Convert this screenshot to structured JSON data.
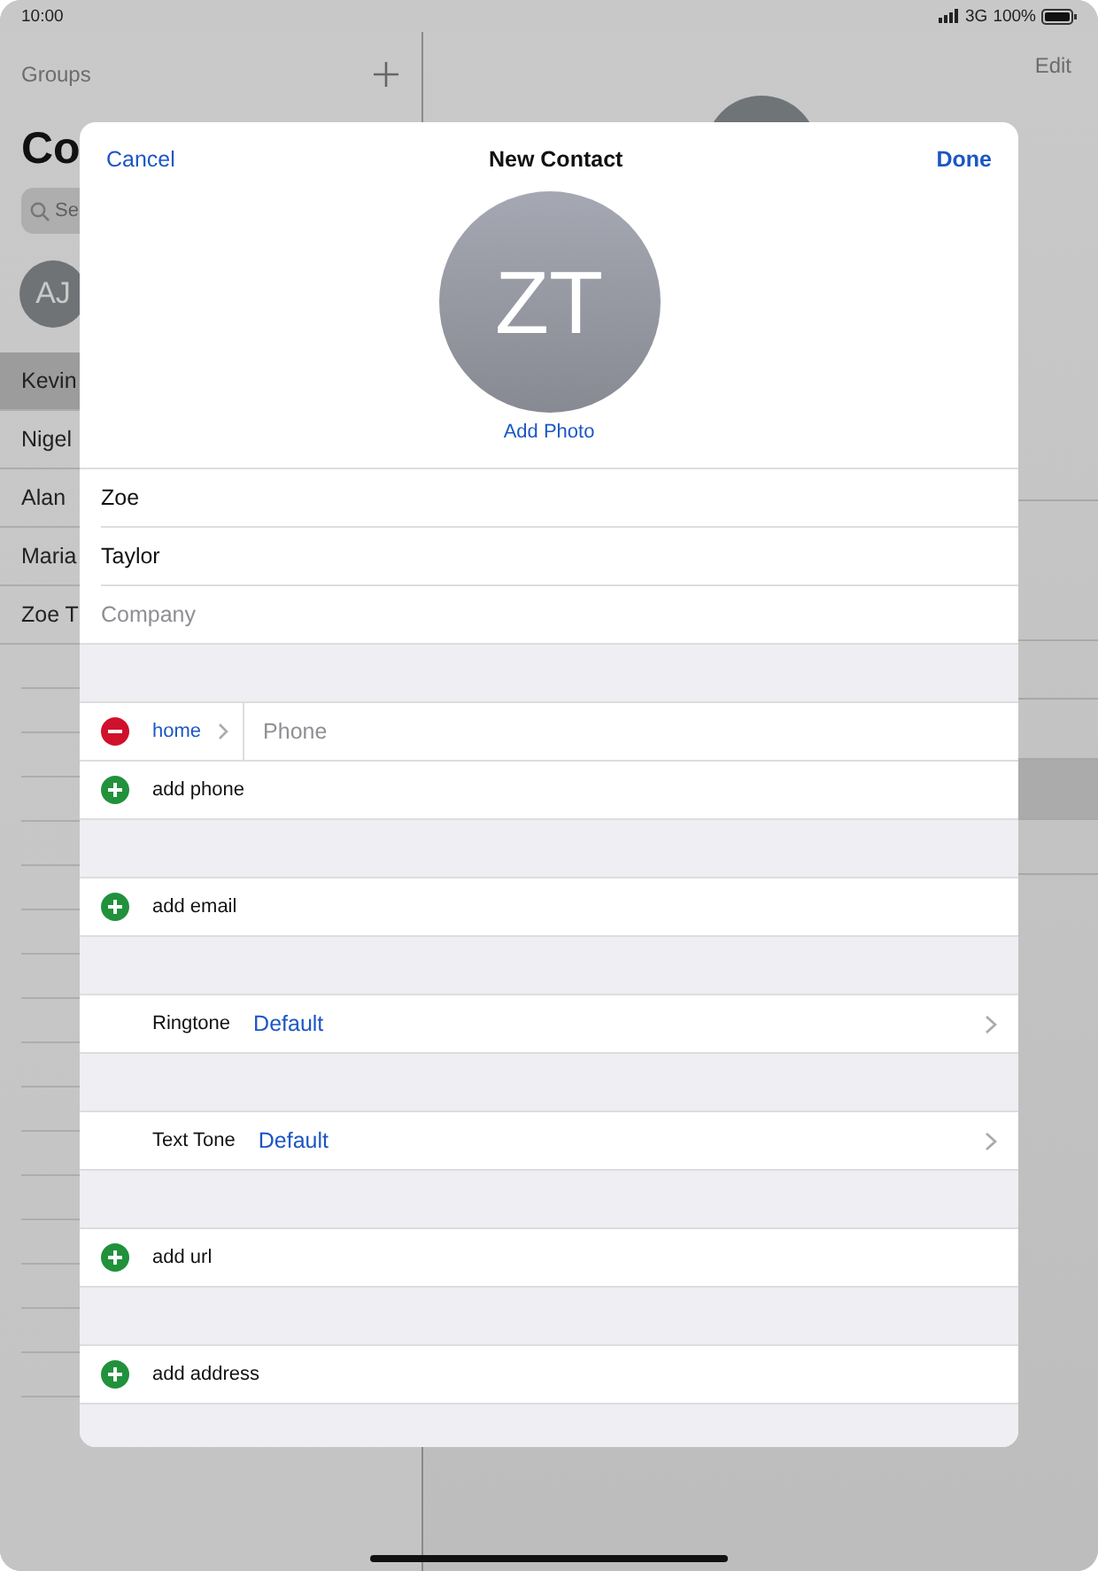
{
  "status_bar": {
    "time": "10:00",
    "network": "3G",
    "battery": "100%"
  },
  "background": {
    "groups_link": "Groups",
    "title": "Co",
    "search_placeholder": "Se",
    "avatar_initials": "AJ",
    "contacts": [
      {
        "name": "Kevin",
        "selected": true
      },
      {
        "name": "Nigel",
        "selected": false
      },
      {
        "name": "Alan",
        "selected": false
      },
      {
        "name": "Maria",
        "selected": false
      },
      {
        "name": "Zoe T",
        "selected": false
      }
    ],
    "edit_link": "Edit"
  },
  "dialog": {
    "cancel": "Cancel",
    "title": "New Contact",
    "done": "Done",
    "avatar_initials": "ZT",
    "add_photo": "Add Photo",
    "name_fields": [
      {
        "value": "Zoe"
      },
      {
        "value": "Taylor"
      },
      {
        "placeholder": "Company"
      }
    ],
    "sections": [
      {
        "rows": [
          {
            "kind": "phone",
            "label": "home",
            "placeholder": "Phone"
          },
          {
            "kind": "add",
            "label": "add phone"
          }
        ]
      },
      {
        "rows": [
          {
            "kind": "add",
            "label": "add email"
          }
        ]
      },
      {
        "rows": [
          {
            "kind": "setting",
            "label": "Ringtone",
            "value": "Default"
          }
        ]
      },
      {
        "rows": [
          {
            "kind": "setting",
            "label": "Text Tone",
            "value": "Default"
          }
        ]
      },
      {
        "rows": [
          {
            "kind": "add",
            "label": "add url"
          }
        ]
      },
      {
        "rows": [
          {
            "kind": "add",
            "label": "add address"
          }
        ]
      }
    ]
  }
}
